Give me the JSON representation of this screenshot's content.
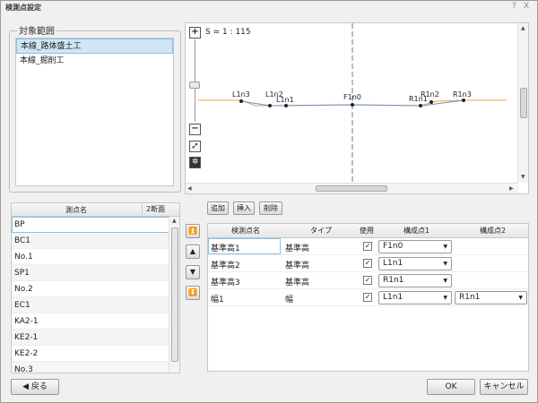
{
  "window": {
    "title": "検測点設定",
    "help": "?",
    "close": "X"
  },
  "range_group": {
    "label": "対象範囲",
    "items": [
      "本線_路体盛土工",
      "本線_掘削工"
    ]
  },
  "preview": {
    "scale": "S = 1 : 115",
    "zoom_in": "+",
    "zoom_out": "−",
    "labels": [
      "L1n3",
      "L1n2",
      "L1n1",
      "F1n0",
      "R1n1",
      "R1n2",
      "R1n3"
    ]
  },
  "edit_buttons": {
    "add": "追加",
    "insert": "挿入",
    "delete": "削除"
  },
  "survey_table": {
    "headers": [
      "測点名",
      "2断面"
    ],
    "rows": [
      "BP",
      "BC1",
      "No.1",
      "SP1",
      "No.2",
      "EC1",
      "KA2-1",
      "KE2-1",
      "KE2-2",
      "No.3"
    ]
  },
  "config_grid": {
    "headers": [
      "検測点名",
      "タイプ",
      "使用",
      "構成点1",
      "構成点2"
    ],
    "rows": [
      {
        "name": "基準高1",
        "type": "基準高",
        "check": "✓",
        "p1": "F1n0",
        "p2": ""
      },
      {
        "name": "基準高2",
        "type": "基準高",
        "check": "✓",
        "p1": "L1n1",
        "p2": ""
      },
      {
        "name": "基準高3",
        "type": "基準高",
        "check": "✓",
        "p1": "R1n1",
        "p2": ""
      },
      {
        "name": "幅1",
        "type": "幅",
        "check": "✓",
        "p1": "L1n1",
        "p2": "R1n1"
      }
    ]
  },
  "footer": {
    "back": "◀ 戻る",
    "ok": "OK",
    "cancel": "キャンセル"
  }
}
